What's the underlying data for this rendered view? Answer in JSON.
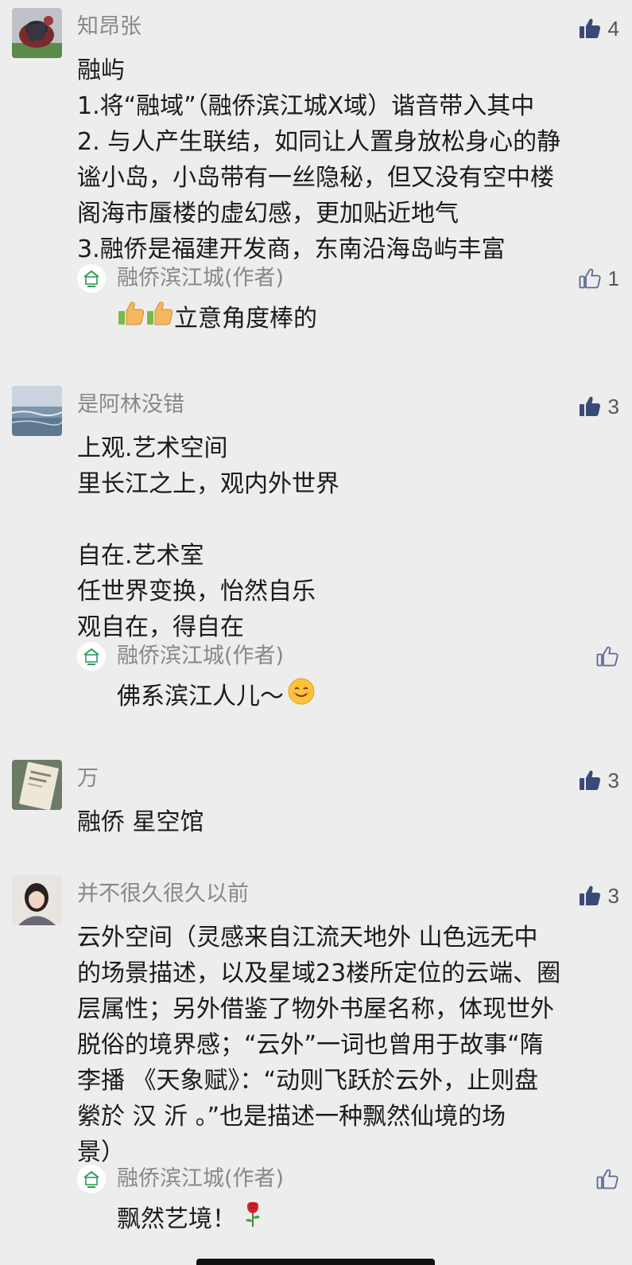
{
  "comments": [
    {
      "nickname": "知昂张",
      "like_count": "4",
      "content": [
        "融屿",
        "1.将“融域”（融侨滨江城X域）谐音带入其中",
        "2. 与人产生联结，如同让人置身放松身心的静",
        "谧小岛，小岛带有一丝隐秘，但又没有空中楼",
        "阁海市蜃楼的虚幻感，更加贴近地气",
        "3.融侨是福建开发商，东南沿海岛屿丰富"
      ],
      "reply": {
        "author": "融侨滨江城(作者)",
        "like_count": "1",
        "emoji_before": [
          "thumbs-up-emoji",
          "thumbs-up-emoji"
        ],
        "text": "立意角度棒的"
      }
    },
    {
      "nickname": "是阿林没错",
      "like_count": "3",
      "content": [
        "上观.艺术空间",
        "里长江之上，观内外世界",
        "",
        "自在.艺术室",
        "任世界变换，怡然自乐",
        "观自在，得自在"
      ],
      "reply": {
        "author": "融侨滨江城(作者)",
        "like_count": "",
        "text": "佛系滨江人儿～",
        "emoji_after": "smiling-face-emoji"
      }
    },
    {
      "nickname": "万",
      "like_count": "3",
      "content": [
        "融侨 星空馆"
      ]
    },
    {
      "nickname": "并不很久很久以前",
      "like_count": "3",
      "content": [
        "云外空间（灵感来自江流天地外 山色远无中",
        "的场景描述，以及星域23楼所定位的云端、圈",
        "层属性；另外借鉴了物外书屋名称，体现世外",
        "脱俗的境界感；“云外”一词也曾用于故事“隋",
        "李播 《天象赋》：“动则飞跃於云外，止则盘",
        "縈於 汉 沂 。”也是描述一种飘然仙境的场",
        "景）"
      ],
      "reply": {
        "author": "融侨滨江城(作者)",
        "like_count": "",
        "text": "飘然艺境！",
        "emoji_after": "rose-emoji"
      }
    }
  ],
  "colors": {
    "background": "#ededed",
    "nickname": "#888888",
    "text": "#1b1b1b",
    "like_filled": "#3a4a78",
    "like_outline": "#5a6a96"
  }
}
